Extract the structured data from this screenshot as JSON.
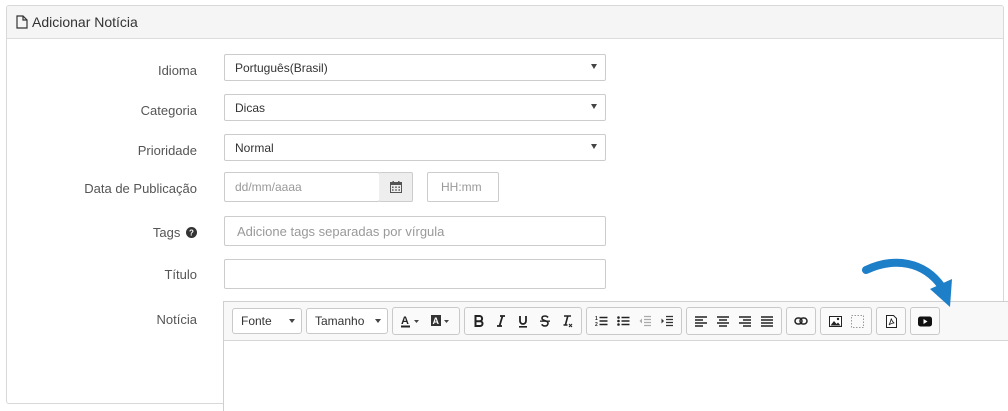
{
  "panel": {
    "title": "Adicionar Notícia",
    "icon": "file-icon"
  },
  "form": {
    "idioma": {
      "label": "Idioma",
      "value": "Português(Brasil)"
    },
    "categoria": {
      "label": "Categoria",
      "value": "Dicas"
    },
    "prioridade": {
      "label": "Prioridade",
      "value": "Normal"
    },
    "data_publicacao": {
      "label": "Data de Publicação",
      "date_placeholder": "dd/mm/aaaa",
      "time_placeholder": "HH:mm"
    },
    "tags": {
      "label": "Tags",
      "placeholder": "Adicione tags separadas por vírgula"
    },
    "titulo": {
      "label": "Título",
      "value": ""
    },
    "noticia": {
      "label": "Notícia"
    }
  },
  "editor": {
    "font_label": "Fonte",
    "size_label": "Tamanho",
    "buttons": [
      "text-color",
      "background-color",
      "bold",
      "italic",
      "underline",
      "strikethrough",
      "remove-format",
      "numbered-list",
      "bulleted-list",
      "decrease-indent",
      "increase-indent",
      "align-left",
      "align-center",
      "align-right",
      "justify",
      "link",
      "image",
      "iframe",
      "pdf",
      "youtube"
    ]
  },
  "colors": {
    "header_bg": "#f5f5f5",
    "arrow": "#1e7fc9"
  }
}
